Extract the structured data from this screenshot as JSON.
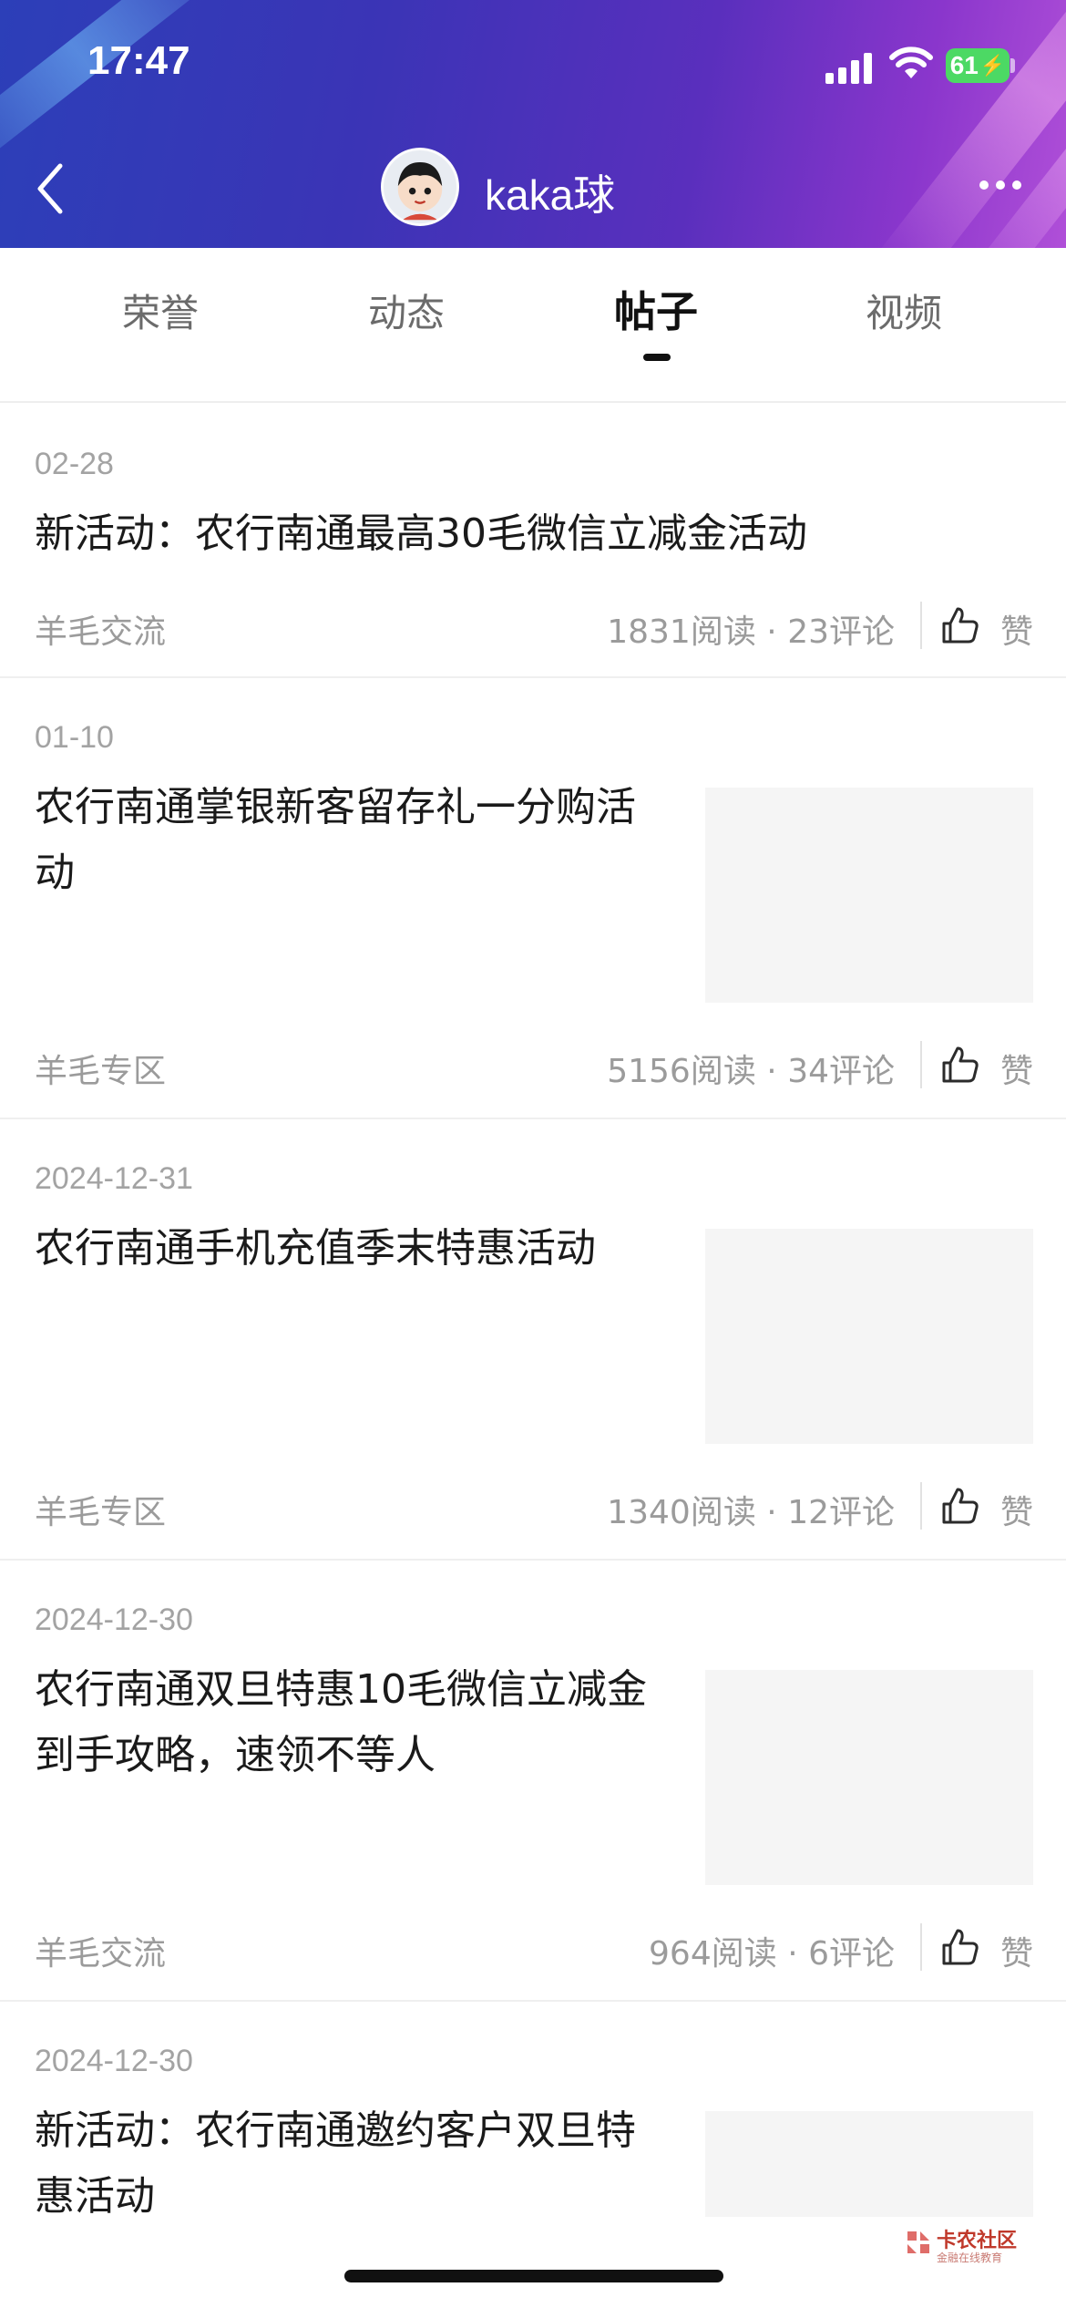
{
  "status_bar": {
    "time": "17:47",
    "battery": "61"
  },
  "header": {
    "profile_name": "kaka球"
  },
  "tabs": [
    {
      "label": "荣誉"
    },
    {
      "label": "动态"
    },
    {
      "label": "帖子"
    },
    {
      "label": "视频"
    }
  ],
  "active_tab": "帖子",
  "posts": [
    {
      "date": "02-28",
      "title": "新活动：农行南通最高30毛微信立减金活动",
      "category": "羊毛交流",
      "reads": "1831阅读",
      "comments": "23评论",
      "like": "赞"
    },
    {
      "date": "01-10",
      "title": "农行南通掌银新客留存礼一分购活动",
      "category": "羊毛专区",
      "reads": "5156阅读",
      "comments": "34评论",
      "like": "赞"
    },
    {
      "date": "2024-12-31",
      "title": "农行南通手机充值季末特惠活动",
      "category": "羊毛专区",
      "reads": "1340阅读",
      "comments": "12评论",
      "like": "赞"
    },
    {
      "date": "2024-12-30",
      "title": "农行南通双旦特惠10毛微信立减金到手攻略，速领不等人",
      "category": "羊毛交流",
      "reads": "964阅读",
      "comments": "6评论",
      "like": "赞"
    },
    {
      "date": "2024-12-30",
      "title": "新活动：农行南通邀约客户双旦特惠活动"
    }
  ],
  "watermark": {
    "name": "卡农社区",
    "sub": "金融在线教育"
  },
  "colors": {
    "header_start": "#2c3fb8",
    "header_end": "#b04fd8",
    "battery": "#4cd964",
    "muted_text": "#9b9b9b"
  }
}
